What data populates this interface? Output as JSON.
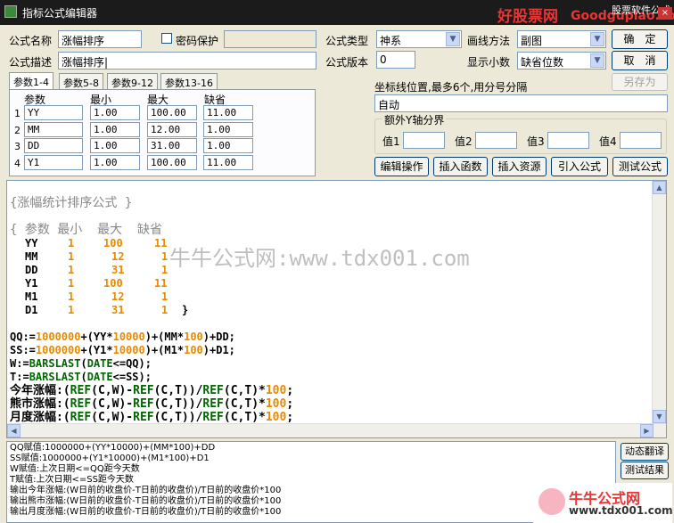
{
  "window": {
    "title": "指标公式编辑器",
    "brand": "好股票网",
    "brand_url": "Goodgupiao.com",
    "brand_sub": "股票软件公式",
    "close": "×"
  },
  "form": {
    "name_label": "公式名称",
    "name_value": "涨幅排序",
    "password_label": "密码保护",
    "desc_label": "公式描述",
    "desc_value": "涨幅排序|",
    "type_label": "公式类型",
    "type_value": "神系",
    "version_label": "公式版本",
    "version_value": "0",
    "draw_label": "画线方法",
    "draw_value": "副图",
    "decimal_label": "显示小数",
    "decimal_value": "缺省位数",
    "ok": "确　定",
    "cancel": "取　消",
    "save_as": "另存为",
    "coord_label": "坐标线位置,最多6个,用分号分隔",
    "coord_value": "自动",
    "yaxis_group": "额外Y轴分界",
    "val1": "值1",
    "val2": "值2",
    "val3": "值3",
    "val4": "值4"
  },
  "tabs": [
    "参数1-4",
    "参数5-8",
    "参数9-12",
    "参数13-16"
  ],
  "params": {
    "headers": [
      "参数",
      "最小",
      "最大",
      "缺省"
    ],
    "rows": [
      {
        "n": "1",
        "name": "YY",
        "min": "1.00",
        "max": "100.00",
        "def": "11.00"
      },
      {
        "n": "2",
        "name": "MM",
        "min": "1.00",
        "max": "12.00",
        "def": "1.00"
      },
      {
        "n": "3",
        "name": "DD",
        "min": "1.00",
        "max": "31.00",
        "def": "1.00"
      },
      {
        "n": "4",
        "name": "Y1",
        "min": "1.00",
        "max": "100.00",
        "def": "11.00"
      }
    ]
  },
  "actions": [
    "编辑操作",
    "插入函数",
    "插入资源",
    "引入公式",
    "测试公式"
  ],
  "watermark": "牛牛公式网:www.tdx001.com",
  "code": {
    "comment": "{涨幅统计排序公式 }",
    "p_head": "{ 参数 最小  最大  缺省",
    "p_rows": [
      [
        "YY",
        "1",
        "100",
        "11"
      ],
      [
        "MM",
        "1",
        "12",
        "1"
      ],
      [
        "DD",
        "1",
        "31",
        "1"
      ],
      [
        "Y1",
        "1",
        "100",
        "11"
      ],
      [
        "M1",
        "1",
        "12",
        "1"
      ],
      [
        "D1",
        "1",
        "31",
        "1"
      ]
    ],
    "p_close": "}",
    "qq": "QQ:=",
    "ss": "SS:=",
    "w": "W:=",
    "t": "T:=",
    "y1_label": "今年涨幅",
    "y2_label": "熊市涨幅",
    "y3_label": "月度涨幅"
  },
  "output": [
    "QQ赋值:1000000+(YY*10000)+(MM*100)+DD",
    "SS赋值:1000000+(Y1*10000)+(M1*100)+D1",
    "W赋值:上次日期<=QQ距今天数",
    "T赋值:上次日期<=SS距今天数",
    "输出今年涨幅:(W日前的收盘价-T日前的收盘价)/T日前的收盘价*100",
    "输出熊市涨幅:(W日前的收盘价-T日前的收盘价)/T日前的收盘价*100",
    "输出月度涨幅:(W日前的收盘价-T日前的收盘价)/T日前的收盘价*100"
  ],
  "side_buttons": [
    "动态翻译",
    "测试结果"
  ],
  "logo2": {
    "title": "牛牛公式网",
    "url": "www.tdx001.com"
  }
}
